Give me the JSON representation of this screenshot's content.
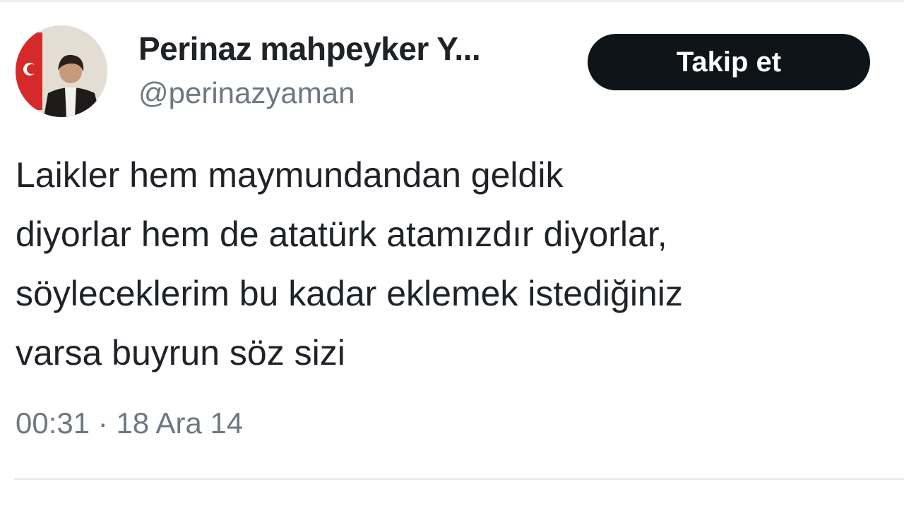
{
  "author": {
    "display_name": "Perinaz mahpeyker Y...",
    "handle": "@perinazyaman"
  },
  "follow_button": {
    "label": "Takip et"
  },
  "tweet": {
    "lines": [
      "Laikler hem maymundandan geldik",
      "diyorlar hem de atatürk atamızdır diyorlar,",
      "söyleceklerim bu kadar eklemek istediğiniz",
      "varsa buyrun söz sizi"
    ],
    "time": "00:31",
    "separator": "·",
    "date": "18 Ara 14"
  },
  "colors": {
    "text_primary": "#1f2328",
    "text_secondary": "#6f7780",
    "button_bg": "#0f1419",
    "flag_red": "#d62a2a"
  }
}
